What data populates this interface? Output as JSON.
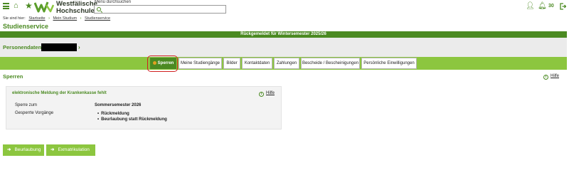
{
  "header": {
    "logo_line1": "Westfälische",
    "logo_line2": "Hochschule",
    "search_label": "Menü durchsuchen",
    "search_placeholder": "",
    "session_timer": "30",
    "icons": [
      "menu-icon",
      "home-icon",
      "star-icon",
      "search-icon",
      "user-icon",
      "bell-icon",
      "logout-icon"
    ]
  },
  "breadcrumb": {
    "prefix": "Sie sind hier:",
    "items": [
      "Startseite",
      "Mein Studium",
      "Studienservice"
    ]
  },
  "page_title": "Studienservice",
  "status_bar": "Rückgemeldet für Wintersemester 2025/26",
  "person": {
    "label": "Personendaten"
  },
  "tabs": [
    {
      "label": "Sperren",
      "active": true
    },
    {
      "label": "Meine Studiengänge"
    },
    {
      "label": "Bilder"
    },
    {
      "label": "Kontaktdaten"
    },
    {
      "label": "Zahlungen"
    },
    {
      "label": "Bescheide / Bescheinigungen"
    },
    {
      "label": "Persönliche Einwilligungen"
    }
  ],
  "section": {
    "title": "Sperren",
    "help": "Hilfe"
  },
  "panel": {
    "title": "elektronische Meldung der Krankenkasse fehlt",
    "help": "Hilfe",
    "rows": [
      {
        "label": "Sperre zum",
        "value": "Sommersemester 2026"
      },
      {
        "label": "Gesperrte Vorgänge",
        "items": [
          "Rückmeldung",
          "Beurlaubung statt Rückmeldung"
        ]
      }
    ]
  },
  "buttons": [
    "Beurlaubung",
    "Exmatrikulation"
  ],
  "colors": {
    "brand_dark": "#4b8a22",
    "brand_light": "#8cc63f",
    "highlight": "#d02020"
  }
}
